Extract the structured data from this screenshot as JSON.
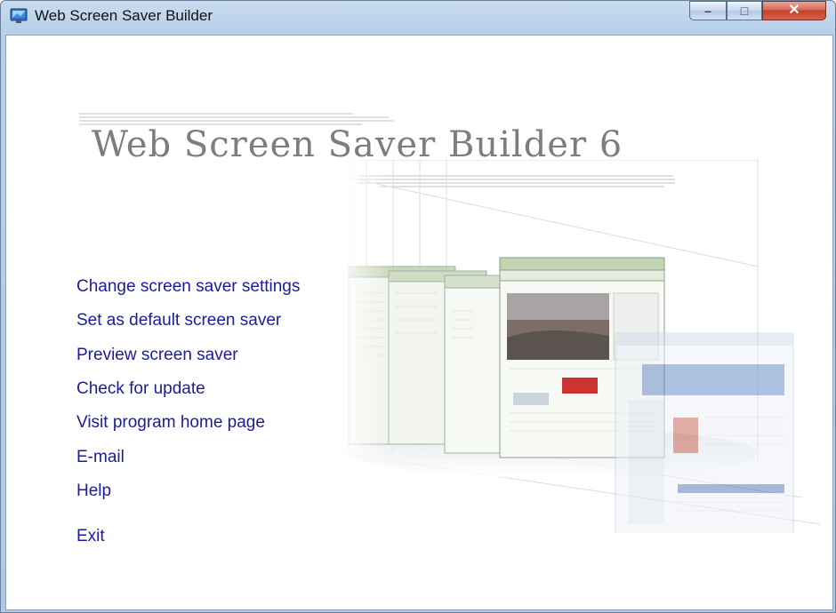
{
  "window": {
    "title": "Web Screen Saver Builder",
    "controls": {
      "minimize": "–",
      "maximize": "□",
      "close": "✕"
    }
  },
  "header": {
    "logo_text": "Web Screen Saver Builder 6"
  },
  "menu": {
    "items": [
      {
        "label": "Change screen saver settings"
      },
      {
        "label": "Set as default screen saver"
      },
      {
        "label": "Preview screen saver"
      },
      {
        "label": "Check for update"
      },
      {
        "label": "Visit program home page"
      },
      {
        "label": "E-mail"
      },
      {
        "label": "Help"
      },
      {
        "label": "Exit"
      }
    ]
  },
  "colors": {
    "link": "#1a1c9c",
    "logo": "#7d7d7d",
    "window_frame": "#b8d0ea"
  },
  "icons": {
    "app": "screen-saver-app-icon"
  }
}
